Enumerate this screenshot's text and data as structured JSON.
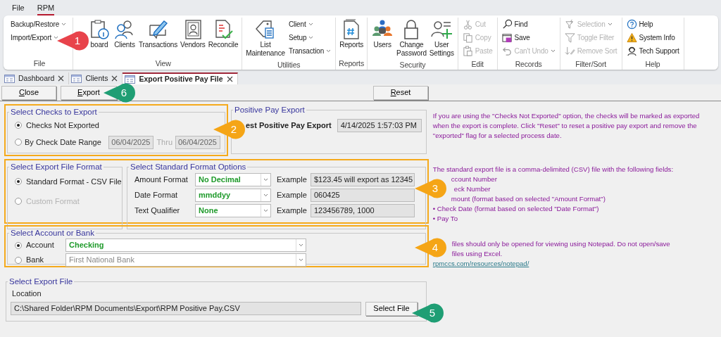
{
  "menu": [
    {
      "label": "File",
      "selected": false
    },
    {
      "label": "RPM",
      "selected": true
    }
  ],
  "ribbon": [
    {
      "label": "File",
      "items": [
        {
          "kind": "small",
          "label": "Backup/Restore",
          "dropdown": true,
          "disabled": false
        },
        {
          "kind": "small",
          "label": "Import/Export",
          "dropdown": true,
          "disabled": false
        }
      ]
    },
    {
      "label": "View",
      "items": [
        {
          "kind": "large",
          "label": "board",
          "disabled": false
        },
        {
          "kind": "large",
          "label": "Clients",
          "disabled": false
        },
        {
          "kind": "large",
          "label": "Transactions",
          "disabled": false
        },
        {
          "kind": "large",
          "label": "Vendors",
          "disabled": false
        },
        {
          "kind": "large",
          "label": "Reconcile",
          "disabled": false
        }
      ]
    },
    {
      "label": "Utilities",
      "items": [
        {
          "kind": "large",
          "label": "List Maintenance",
          "disabled": false
        },
        {
          "kind": "small",
          "label": "Client",
          "dropdown": true,
          "disabled": false
        },
        {
          "kind": "small",
          "label": "Setup",
          "dropdown": true,
          "disabled": false
        },
        {
          "kind": "small",
          "label": "Transaction",
          "dropdown": true,
          "disabled": false
        }
      ]
    },
    {
      "label": "Reports",
      "items": [
        {
          "kind": "large",
          "label": "Reports",
          "disabled": false
        }
      ]
    },
    {
      "label": "Security",
      "items": [
        {
          "kind": "large",
          "label": "Users",
          "disabled": false
        },
        {
          "kind": "large",
          "label": "Change Password",
          "disabled": false
        },
        {
          "kind": "large",
          "label": "User Settings",
          "disabled": false
        }
      ]
    },
    {
      "label": "Edit",
      "items": [
        {
          "kind": "small",
          "label": "Cut",
          "disabled": true
        },
        {
          "kind": "small",
          "label": "Copy",
          "disabled": true
        },
        {
          "kind": "small",
          "label": "Paste",
          "disabled": true
        }
      ]
    },
    {
      "label": "Records",
      "items": [
        {
          "kind": "small",
          "label": "Find",
          "disabled": false
        },
        {
          "kind": "small",
          "label": "Save",
          "disabled": false
        },
        {
          "kind": "small",
          "label": "Can't Undo",
          "dropdown": true,
          "disabled": true
        }
      ]
    },
    {
      "label": "Filter/Sort",
      "items": [
        {
          "kind": "small",
          "label": "Selection",
          "dropdown": true,
          "disabled": true
        },
        {
          "kind": "small",
          "label": "Toggle Filter",
          "disabled": true
        },
        {
          "kind": "small",
          "label": "Remove Sort",
          "disabled": true
        }
      ]
    },
    {
      "label": "Help",
      "items": [
        {
          "kind": "small",
          "label": "Help",
          "disabled": false
        },
        {
          "kind": "small",
          "label": "System Info",
          "disabled": false
        },
        {
          "kind": "small",
          "label": "Tech Support",
          "disabled": false
        }
      ]
    }
  ],
  "tabs": [
    {
      "label": "Dashboard",
      "selected": false
    },
    {
      "label": "Clients",
      "selected": false
    },
    {
      "label": "Export Positive Pay File",
      "selected": true
    }
  ],
  "toolbar": [
    {
      "label": "Close",
      "mnemonic": true
    },
    {
      "label": "Export",
      "mnemonic": true
    },
    {
      "label": "Reset",
      "mnemonic": true
    }
  ],
  "checks": {
    "title": "Select Checks to Export",
    "highlighted": true,
    "options": [
      {
        "label": "Checks Not Exported",
        "selected": true
      },
      {
        "label": "By Check Date Range",
        "selected": false,
        "from": "06/04/2025",
        "thru_label": "Thru",
        "to": "06/04/2025"
      }
    ]
  },
  "positive_pay_export": {
    "title": "Positive Pay Export",
    "label": "est Positive Pay Export",
    "value": "4/14/2025 1:57:03 PM"
  },
  "format_section": {
    "highlighted": true,
    "file_format": {
      "title": "Select Export File Format",
      "options": [
        {
          "label": "Standard Format - CSV File",
          "selected": true,
          "disabled": false
        },
        {
          "label": "Custom Format",
          "selected": false,
          "disabled": true
        }
      ]
    },
    "options": {
      "title": "Select Standard Format Options",
      "rows": [
        {
          "label": "Amount Format",
          "value": "No Decimal",
          "example_label": "Example",
          "example": "$123.45 will export as 12345"
        },
        {
          "label": "Date Format",
          "value": "mmddyy",
          "example_label": "Example",
          "example": "060425"
        },
        {
          "label": "Text Qualifier",
          "value": "None",
          "example_label": "Example",
          "example": "123456789, 1000"
        }
      ]
    }
  },
  "account": {
    "title": "Select Account or Bank",
    "highlighted": true,
    "options": [
      {
        "label": "Account",
        "selected": true,
        "value": "Checking"
      },
      {
        "label": "Bank",
        "selected": false,
        "value": "First National Bank"
      }
    ]
  },
  "export_file": {
    "title": "Select Export File",
    "location_label": "Location",
    "path": "C:\\Shared Folder\\RPM Documents\\Export\\RPM Positive Pay.CSV",
    "button": "Select File"
  },
  "help_text": {
    "paragraph": "If you are using the \"Checks Not Exported\" option, the checks will be marked as exported when the export is complete. Click \"Reset\" to reset a positive pay export and remove the \"exported\" flag for a selected process date.",
    "fields_intro": "The standard export file is a comma-delimited (CSV) file with the following fields:",
    "fields": [
      "ccount Number",
      "eck Number",
      "mount (format based on selected \"Amount Format\")",
      "• Check Date (format based on selected \"Date Format\")",
      "• Pay To"
    ],
    "note_lines": [
      "files should only be opened for viewing using Notepad. Do not open/save",
      "files using Excel."
    ],
    "link": "rpmccs.com/resources/notepad/"
  },
  "callouts": [
    {
      "number": "1",
      "color": "#e8434b"
    },
    {
      "number": "2",
      "color": "#f5a516"
    },
    {
      "number": "3",
      "color": "#f5a516"
    },
    {
      "number": "4",
      "color": "#f5a516"
    },
    {
      "number": "5",
      "color": "#1f9e74"
    },
    {
      "number": "6",
      "color": "#1f9e74"
    }
  ]
}
